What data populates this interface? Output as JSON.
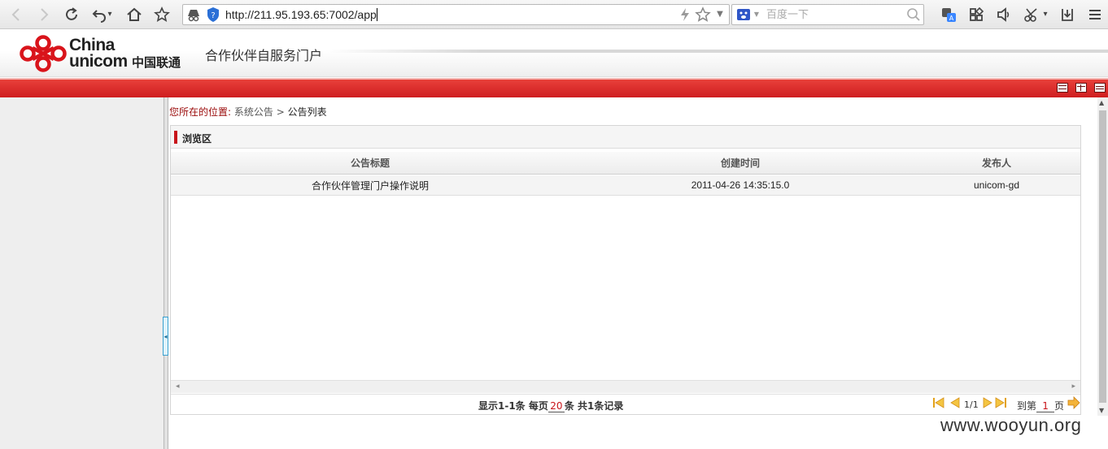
{
  "browser": {
    "url": "http://211.95.193.65:7002/app",
    "search_placeholder": "百度一下"
  },
  "header": {
    "logo_en_1": "China",
    "logo_en_2": "unicom",
    "logo_cn": "中国联通",
    "portal_title": "合作伙伴自服务门户"
  },
  "breadcrumb": {
    "prefix": "您所在的位置:",
    "parent": "系统公告",
    "separator": ">",
    "current": "公告列表"
  },
  "panel": {
    "title": "浏览区",
    "columns": [
      "公告标题",
      "创建时间",
      "发布人"
    ],
    "rows": [
      [
        "合作伙伴管理门户操作说明",
        "2011-04-26 14:35:15.0",
        "unicom-gd"
      ]
    ]
  },
  "pager": {
    "summary_prefix": "显示1-1条 每页",
    "page_size": "20",
    "summary_suffix": "条 共1条记录",
    "page_info": "1/1",
    "goto_prefix": "到第",
    "goto_value": "1",
    "goto_suffix": "页"
  },
  "watermark": "www.wooyun.org",
  "colors": {
    "brand_red": "#cf1d1f",
    "breadcrumb_red": "#9b0b0b"
  }
}
